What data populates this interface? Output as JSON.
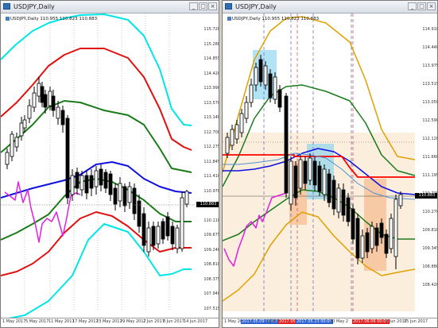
{
  "colors": {
    "bb_outer": "#00e5e5",
    "bb_mid": "#e01010",
    "bb_inner": "#1a7a1a",
    "ma_blue": "#1010e0",
    "chikou": "#e020e0",
    "kijun_red": "#ff0000",
    "band_orange": "#e0a000",
    "highlight_blue": "#7fd0ef",
    "highlight_orange": "#f5b080",
    "bg_beige": "#fbeedc",
    "xaxis_highlight_blue": "#2a60d0",
    "xaxis_highlight_red": "#e02020"
  },
  "left": {
    "window_title": "USDJPY,Daily",
    "info_line": "USDJPY,Daily  110.955 110.823 110.883",
    "yaxis_labels": [
      "115.720",
      "115.280",
      "114.855",
      "114.420",
      "113.990",
      "113.570",
      "113.140",
      "112.700",
      "112.275",
      "111.845",
      "111.410",
      "110.970",
      "110.530",
      "110.110",
      "109.675",
      "109.240",
      "108.810",
      "108.375",
      "107.940",
      "107.515"
    ],
    "current_price": "110.883",
    "xaxis_labels": [
      "1 May 2017",
      "5 May 2017",
      "11 May 2017",
      "17 May 2017",
      "23 May 2017",
      "29 May 2017",
      "2 Jun 2017",
      "8 Jun 2017",
      "14 Jun 2017"
    ],
    "window_buttons": [
      "_",
      "□",
      "×"
    ]
  },
  "right": {
    "window_title": "USDJPY,Daily",
    "info_line": "USDJPY,Daily  110.955 110.823 110.883",
    "yaxis_labels": [
      "114.910",
      "114.440",
      "113.975",
      "113.515",
      "113.050",
      "112.590",
      "112.120",
      "111.660",
      "111.195",
      "110.735",
      "110.270",
      "109.810",
      "109.345",
      "108.880",
      "108.420"
    ],
    "current_price": "110.883",
    "xaxis_labels": [
      {
        "text": "1 May 2017",
        "hl": ""
      },
      {
        "text": "2017.05.09 00:00",
        "hl": "blue"
      },
      {
        "text": "11 M",
        "hl": ""
      },
      {
        "text": "2017.05.16",
        "hl": "red"
      },
      {
        "text": "2017.05.23 00:00",
        "hl": "blue"
      },
      {
        "text": "30 May 2",
        "hl": ""
      },
      {
        "text": "2017.06.06 00:00",
        "hl": "red"
      },
      {
        "text": "9 Jun 2017",
        "hl": ""
      },
      {
        "text": "15 Jun 2017",
        "hl": ""
      }
    ],
    "window_buttons": [
      "_",
      "□",
      "×"
    ]
  }
}
